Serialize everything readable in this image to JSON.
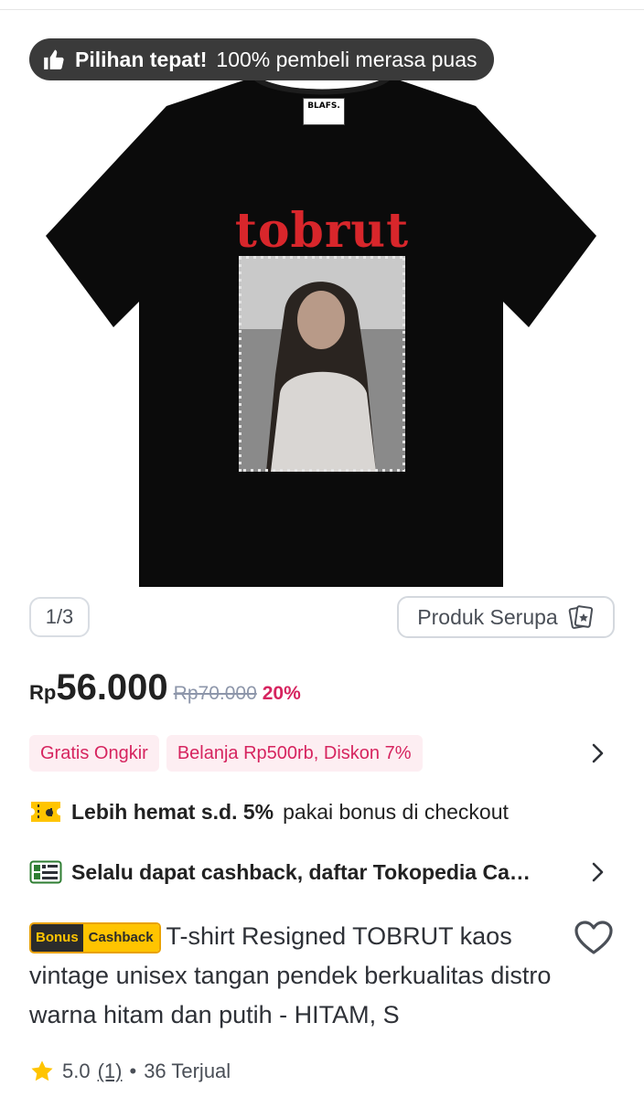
{
  "banner": {
    "highlight": "Pilihan tepat!",
    "text": "100% pembeli merasa puas",
    "icon": "thumbs-up-icon"
  },
  "gallery": {
    "counter": "1/3",
    "similar_button": "Produk Serupa",
    "similar_icon": "cards-icon",
    "print_text": "tobrut",
    "tag_text": "BLAFS."
  },
  "price": {
    "currency": "Rp",
    "amount": "56.000",
    "original": "Rp70.000",
    "discount": "20%"
  },
  "promos": [
    {
      "label": "Gratis Ongkir"
    },
    {
      "label": "Belanja Rp500rb, Diskon 7%"
    }
  ],
  "bonus_line": {
    "strong": "Lebih hemat s.d. 5%",
    "text": "pakai bonus di checkout",
    "icon": "ticket-icon"
  },
  "cashback_line": {
    "strong": "Selalu dapat cashback, daftar Tokopedia Ca…",
    "icon": "card-icon"
  },
  "product": {
    "badge_left": "Bonus",
    "badge_right": "Cashback",
    "title": "T-shirt Resigned TOBRUT kaos vintage unisex tangan pendek berkualitas distro warna hitam dan putih - HITAM, S"
  },
  "rating": {
    "score": "5.0",
    "count": "(1)",
    "sold": "36 Terjual"
  },
  "colors": {
    "accent_pink": "#d6245f",
    "chip_bg": "#fdeef2",
    "star": "#ffc400",
    "dark_pill": "#3a3a3a",
    "print_red": "#d8262b"
  }
}
